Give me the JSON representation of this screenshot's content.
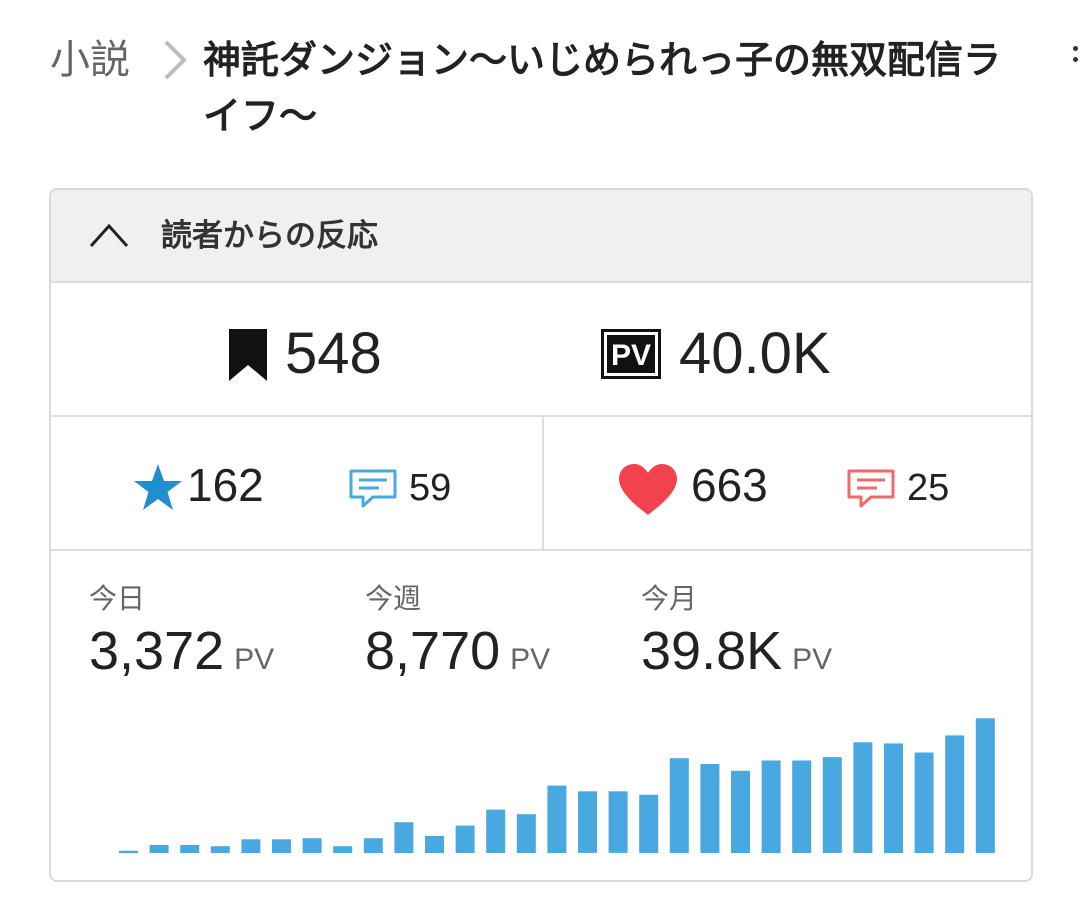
{
  "breadcrumb": {
    "root": "小説",
    "title": "神託ダンジョン〜いじめられっ子の無双配信ライフ〜"
  },
  "panel": {
    "title": "読者からの反応",
    "bookmarks": "548",
    "pv_total": "40.0K",
    "pv_icon_text": "PV",
    "stars": "162",
    "star_comments": "59",
    "hearts": "663",
    "heart_comments": "25"
  },
  "pv_stats": [
    {
      "label": "今日",
      "value": "3,372",
      "unit": "PV"
    },
    {
      "label": "今週",
      "value": "8,770",
      "unit": "PV"
    },
    {
      "label": "今月",
      "value": "39.8K",
      "unit": "PV"
    }
  ],
  "colors": {
    "bar": "#4aa8e0",
    "star": "#1f8fd0",
    "heart": "#f2424e",
    "comment_blue": "#4aa8e0",
    "comment_red": "#ef6a6a"
  },
  "chart_data": {
    "type": "bar",
    "values": [
      2,
      7,
      7,
      6,
      12,
      12,
      13,
      6,
      13,
      27,
      15,
      24,
      38,
      34,
      59,
      54,
      54,
      51,
      83,
      78,
      72,
      81,
      81,
      84,
      97,
      96,
      88,
      103,
      118
    ],
    "ylim": [
      0,
      120
    ],
    "grid": false
  }
}
